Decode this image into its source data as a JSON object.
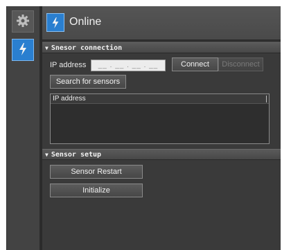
{
  "header": {
    "title": "Online",
    "icon": "lightning-icon"
  },
  "rail": {
    "items": [
      {
        "icon": "gear-icon"
      },
      {
        "icon": "lightning-icon"
      }
    ]
  },
  "connection": {
    "section_title": "Snesor connection",
    "ip_label": "IP address",
    "ip_placeholder": "__ . __ . __ . __",
    "connect_label": "Connect",
    "disconnect_label": "Disconnect",
    "search_label": "Search for sensors",
    "list_header": "IP address"
  },
  "setup": {
    "section_title": "Sensor setup",
    "restart_label": "Sensor Restart",
    "initialize_label": "Initialize"
  },
  "colors": {
    "accent": "#2a7fd0",
    "panel": "#3a3a3a",
    "rail": "#434343"
  }
}
